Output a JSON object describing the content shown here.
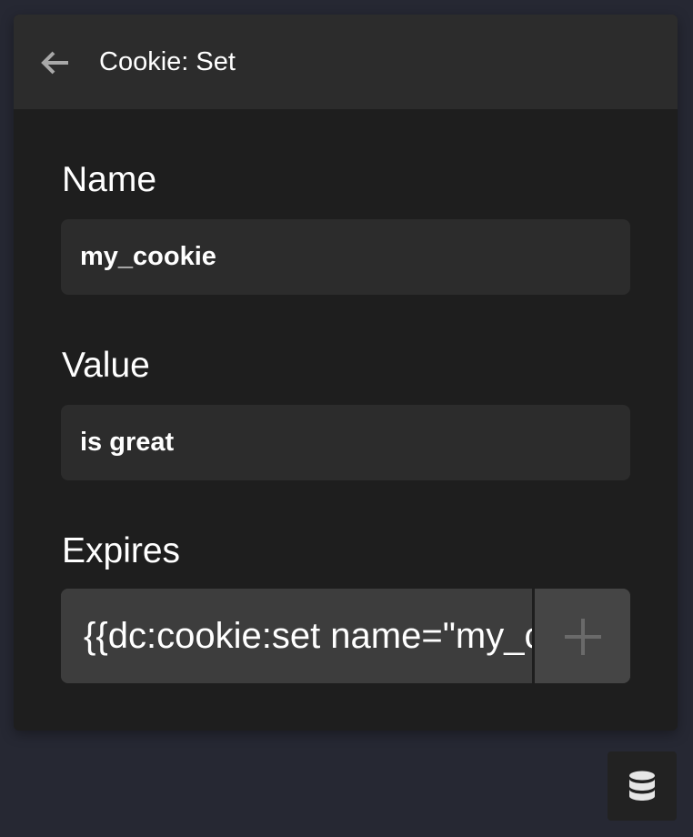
{
  "header": {
    "title": "Cookie: Set",
    "back_icon": "arrow-left-icon"
  },
  "fields": {
    "name": {
      "label": "Name",
      "value": "my_cookie"
    },
    "value": {
      "label": "Value",
      "value": "is great"
    },
    "expires": {
      "label": "Expires",
      "value": "{{dc:cookie:set name=\"my_cookie\" value=\"is great\"}}",
      "add_icon": "plus-icon"
    }
  },
  "floating_button": {
    "icon": "database-icon"
  },
  "colors": {
    "page_background": "#262833",
    "panel_background": "#1e1e1e",
    "header_background": "#2c2c2c",
    "input_background": "#2c2c2c",
    "expires_background": "#3d3d3d",
    "add_button_background": "#454545"
  }
}
